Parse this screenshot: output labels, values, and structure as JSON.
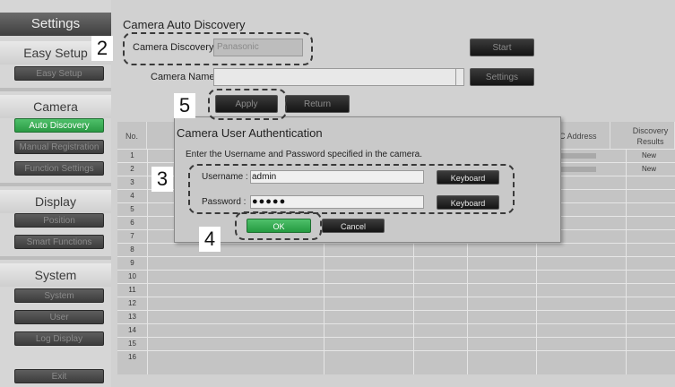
{
  "sidebar": {
    "settings_label": "Settings",
    "easy_setup_header": "Easy Setup",
    "easy_setup_btn": "Easy Setup",
    "camera_header": "Camera",
    "auto_discovery": "Auto Discovery",
    "manual_registration": "Manual Registration",
    "function_settings": "Function Settings",
    "display_header": "Display",
    "position": "Position",
    "smart_functions": "Smart Functions",
    "system_header": "System",
    "system_btn": "System",
    "user_btn": "User",
    "log_display": "Log Display",
    "exit": "Exit"
  },
  "page": {
    "title": "Camera Auto Discovery",
    "camera_discovery_label": "Camera Discovery",
    "camera_discovery_value": "Panasonic",
    "start_button": "Start",
    "camera_name_label": "Camera Name",
    "camera_name_value": "",
    "settings_button": "Settings",
    "apply_button": "Apply",
    "return_button": "Return"
  },
  "table": {
    "col_no": "No.",
    "col_mac": "MAC Address",
    "col_results": "Discovery Results",
    "rows": [
      "1",
      "2",
      "3",
      "4",
      "5",
      "6",
      "7",
      "8",
      "9",
      "10",
      "11",
      "12",
      "13",
      "14",
      "15",
      "16"
    ],
    "results": [
      "New",
      "New"
    ]
  },
  "dialog": {
    "title": "Camera User Authentication",
    "instruction": "Enter the Username and Password specified in the camera.",
    "username_label": "Username :",
    "username_value": "admin",
    "password_label": "Password :",
    "password_value": "●●●●●",
    "keyboard_button": "Keyboard",
    "ok_button": "OK",
    "cancel_button": "Cancel"
  },
  "callouts": {
    "step2": "2",
    "step3": "3",
    "step4": "4",
    "step5": "5"
  }
}
